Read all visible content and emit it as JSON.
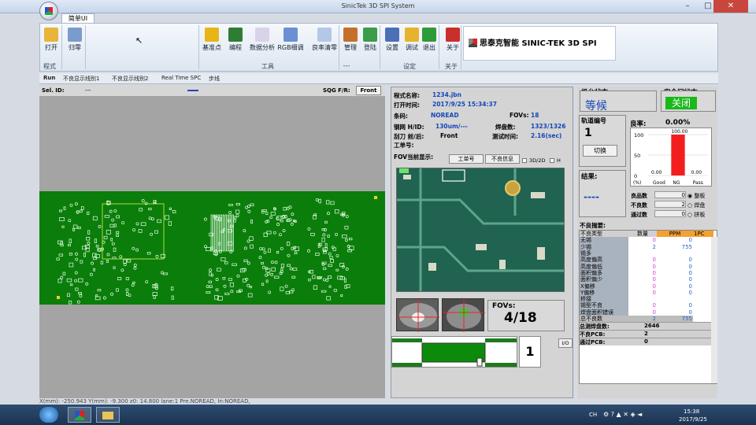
{
  "window": {
    "title": "SinicTek 3D SPI System",
    "menu_tab": "简单UI"
  },
  "ribbon": {
    "buttons": [
      {
        "label": "打开",
        "icon": "folder-icon",
        "color": "#e9b43a"
      },
      {
        "label": "归零",
        "icon": "home-icon",
        "color": "#7a9ccc"
      },
      {
        "label": "基准点",
        "icon": "crop-icon",
        "color": "#e8b417"
      },
      {
        "label": "编程",
        "icon": "grid-icon",
        "color": "#2e7d32"
      },
      {
        "label": "数据分析",
        "icon": "chart-icon",
        "color": "#d9d3ea"
      },
      {
        "label": "RGB细调",
        "icon": "rgb-icon",
        "color": "#6c8fd4"
      },
      {
        "label": "良率清零",
        "icon": "clock-icon",
        "color": "#b5c7e6"
      },
      {
        "label": "管理",
        "icon": "users-icon",
        "color": "#c56f2a"
      },
      {
        "label": "登陆",
        "icon": "user-icon",
        "color": "#3b9c4a"
      },
      {
        "label": "设置",
        "icon": "gears-icon",
        "color": "#4b70b8"
      },
      {
        "label": "调试",
        "icon": "wrench-icon",
        "color": "#e6b32d"
      },
      {
        "label": "退出",
        "icon": "exit-icon",
        "color": "#2f9a3a"
      },
      {
        "label": "关于",
        "icon": "info-icon",
        "color": "#c9302c"
      }
    ],
    "groups": [
      "程式",
      "工具",
      "---",
      "设定",
      "关于"
    ],
    "brand": "思泰克智能 SINIC-TEK 3D SPI"
  },
  "subtabs": [
    "Run",
    "不良显示线别1",
    "不良显示线别2",
    "Real Time SPC",
    "步线"
  ],
  "left": {
    "sel_id_label": "Sel. ID:",
    "sel_id_value": "---",
    "sqg_label": "SQG F/R:",
    "sqg_value": "Front",
    "status": "X(mm): -250.943     Y(mm): -9.300 z0: 14.800  lane:1 Pre.NOREAD,  In:NOREAD,"
  },
  "program": {
    "name_label": "程式名称:",
    "name": "1234.jbn",
    "open_label": "打开时间:",
    "open": "2017/9/25 15:34:37",
    "barcode_label": "条码:",
    "barcode": "NOREAD",
    "fovs_label": "FOVs:",
    "fovs": "18",
    "stencil_label": "钢网 H/ID:",
    "stencil": "130um/---",
    "pads_label": "焊盘数:",
    "pads": "1323/1326",
    "squeegee_label": "刮刀 前/后:",
    "squeegee": "Front",
    "test_time_label": "测试时间:",
    "test_time": "2.16(sec)",
    "work_order_label": "工单号:",
    "fov_display_label": "FOV当前显示:",
    "btn_work_order": "工单号",
    "btn_defect_info": "不良信息",
    "chk_3d2d": "3D/2D",
    "chk_h": "H",
    "fov_counter_label": "FOVs:",
    "fov_counter": "4/18",
    "lane_number": "1",
    "btn_io": "I/O"
  },
  "status": {
    "machine_label": "机台状态:",
    "machine": "等候",
    "door_label": "安全门状态:",
    "door": "关闭",
    "track_label": "轨道编号",
    "track": "1",
    "switch_btn": "切换",
    "result_label": "结果:",
    "result": "----",
    "yield_label": "良率:",
    "yield": "0.00%",
    "yield_chart": {
      "type": "bar",
      "categories": [
        "Good",
        "NG",
        "Pass"
      ],
      "values": [
        0.0,
        100.0,
        0.0
      ],
      "ylim": [
        0,
        100
      ],
      "ylabel": "(%)",
      "ticks": [
        100,
        50,
        0
      ]
    },
    "good_label": "良品数",
    "good": "0",
    "ng_label": "不良数",
    "ng": "2",
    "pass_label": "通过数",
    "pass": "0",
    "mode_options": [
      "整板",
      "焊盘",
      "拼板"
    ]
  },
  "defects": {
    "title": "不良揣要:",
    "headers": [
      "不良类型",
      "数量",
      "PPM",
      "1PC"
    ],
    "rows": [
      [
        "无锡",
        "0",
        "0"
      ],
      [
        "少锡",
        "2",
        "755"
      ],
      [
        "锡多",
        "",
        ""
      ],
      [
        "高度偏高",
        "0",
        "0"
      ],
      [
        "高度偏低",
        "0",
        "0"
      ],
      [
        "面积偏多",
        "0",
        "0"
      ],
      [
        "面积偏少",
        "0",
        "0"
      ],
      [
        "X偏移",
        "0",
        "0"
      ],
      [
        "Y偏移",
        "0",
        "0"
      ],
      [
        "桥接",
        "",
        ""
      ],
      [
        "锡型不良",
        "0",
        "0"
      ],
      [
        "焊盘面积错误",
        "0",
        "0"
      ],
      [
        "总不良数",
        "2",
        "755"
      ]
    ],
    "summary": [
      [
        "总测焊盘数:",
        "2646"
      ],
      [
        "不良PCB:",
        "2"
      ],
      [
        "通过PCB:",
        "0"
      ]
    ]
  },
  "taskbar": {
    "time": "15:38",
    "date": "2017/9/25",
    "tray": "CH"
  }
}
